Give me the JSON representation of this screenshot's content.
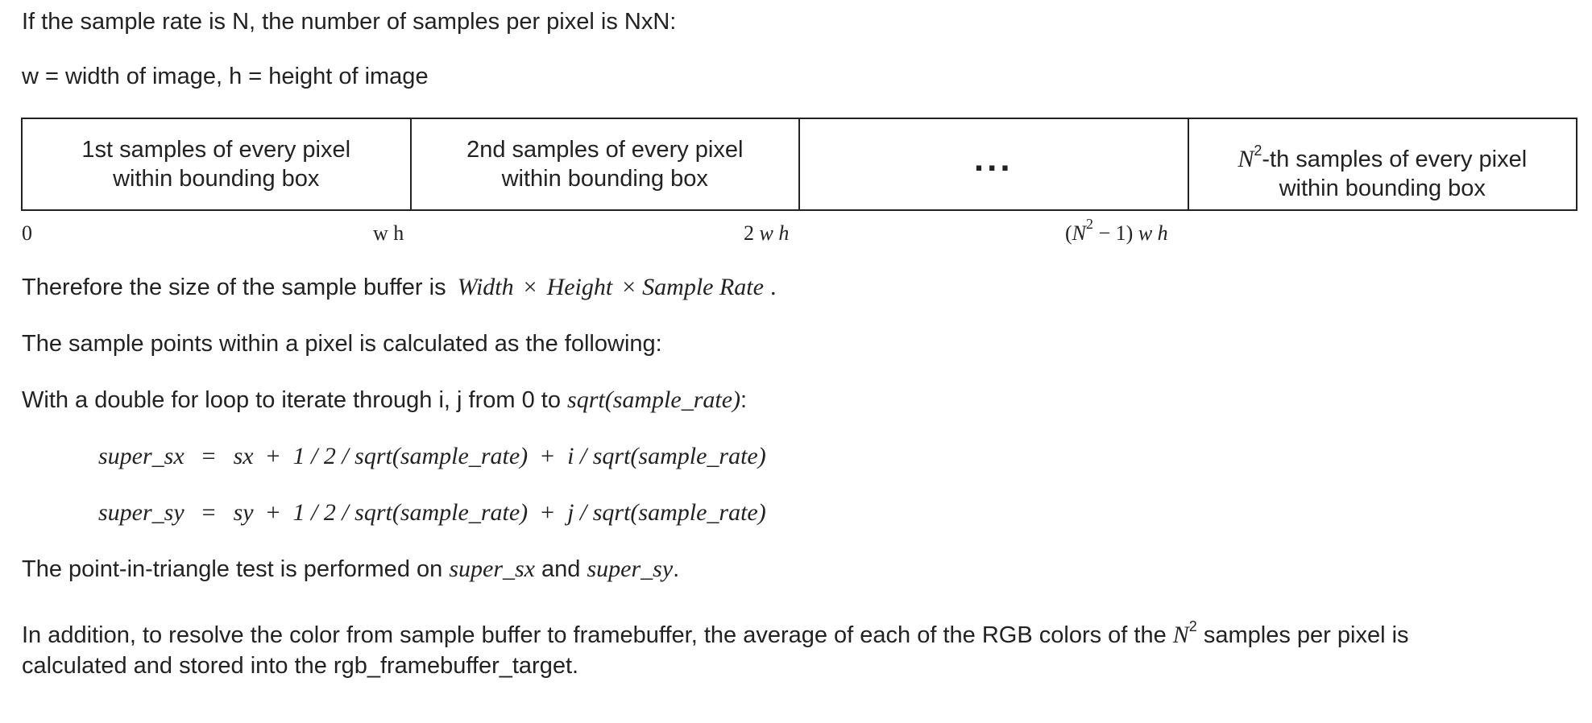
{
  "intro": {
    "line1": "If the sample rate is N, the number of samples per pixel is NxN:",
    "line2": "w = width of image, h = height of image"
  },
  "buffer_table": {
    "cells": [
      {
        "line1": "1st samples of every pixel",
        "line2": "within bounding box"
      },
      {
        "line1": "2nd samples of every pixel",
        "line2": "within bounding box"
      },
      {
        "text": "..."
      },
      {
        "base": "N",
        "exp": "2",
        "line1_rest": "-th samples of every pixel",
        "line2": "within bounding box"
      }
    ],
    "offsets": {
      "zero": "0",
      "wh": "w h",
      "two": "2",
      "two_wh": "w h",
      "last_open": "(",
      "last_base": "N",
      "last_exp": "2",
      "last_minus": " − 1)",
      "last_wh": "w h"
    }
  },
  "buffer_size": {
    "prefix": "Therefore the size of the sample buffer is",
    "width": "Width",
    "times": "×",
    "height": "Height",
    "rate": "Sample Rate",
    "period": "."
  },
  "sample_points": {
    "text": "The sample points within a pixel is calculated as the following:"
  },
  "loop": {
    "prefix": "With a double for loop to iterate through i, j from 0 to",
    "expr": "sqrt(sample_rate)",
    "suffix": ":"
  },
  "equations": {
    "sx": {
      "lhs": "super_sx",
      "eq": "=",
      "var": "sx",
      "plus": "+",
      "half": "1 / 2 / sqrt(sample_rate)",
      "plus2": "+",
      "frac": "i / sqrt(sample_rate)"
    },
    "sy": {
      "lhs": "super_sy",
      "eq": "=",
      "var": "sy",
      "plus": "+",
      "half": "1 / 2 / sqrt(sample_rate)",
      "plus2": "+",
      "frac": "j / sqrt(sample_rate)"
    }
  },
  "test": {
    "prefix": "The point-in-triangle test is performed on",
    "var1": "super_sx",
    "and": "and",
    "var2": "super_sy",
    "suffix": "."
  },
  "resolve": {
    "line1_prefix": "In addition, to resolve the color from sample buffer to framebuffer, the average of each of the RGB colors of the",
    "base": "N",
    "exp": "2",
    "line1_suffix": "samples per pixel is",
    "line2": "calculated and stored into the rgb_framebuffer_target."
  }
}
